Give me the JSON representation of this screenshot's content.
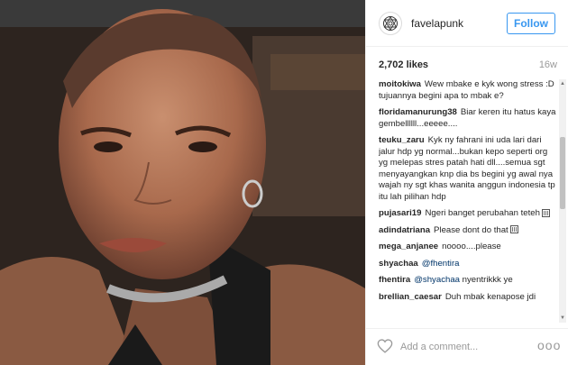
{
  "post": {
    "username": "favelapunk",
    "follow_label": "Follow",
    "likes": "2,702 likes",
    "time": "16w",
    "comments": [
      {
        "user": "moitokiwa",
        "text": "Wew mbake e kyk wong stress :D tujuannya begini apa to mbak e?"
      },
      {
        "user": "floridamanurung38",
        "text": "Biar keren itu hatus kaya gembellllll...eeeee...."
      },
      {
        "user": "teuku_zaru",
        "text": "Kyk ny fahrani ini uda lari dari jalur hdp yg normal...bukan kepo seperti org yg melepas stres patah hati dll....semua sgt menyayangkan knp dia bs begini yg awal nya wajah ny sgt khas wanita anggun indonesia tp itu lah pilihan hdp"
      },
      {
        "user": "pujasari19",
        "text": "Ngeri banget perubahan teteh"
      },
      {
        "user": "adindatriana",
        "text": "Please dont do that"
      },
      {
        "user": "mega_anjanee",
        "text": "noooo....please"
      },
      {
        "user": "shyachaa",
        "mention": "@fhentira",
        "text": ""
      },
      {
        "user": "fhentira",
        "mention": "@shyachaa",
        "text": "nyentrikkk ye"
      },
      {
        "user": "brellian_caesar",
        "text": "Duh mbak kenapose jdi"
      }
    ],
    "add_comment_placeholder": "Add a comment...",
    "more_label": "ooo"
  },
  "icons": {
    "avatar": "sacred-geometry-logo-icon",
    "like": "heart-icon",
    "more": "more-options-icon"
  },
  "colors": {
    "accent": "#3897f0",
    "text": "#262626",
    "muted": "#999999"
  }
}
